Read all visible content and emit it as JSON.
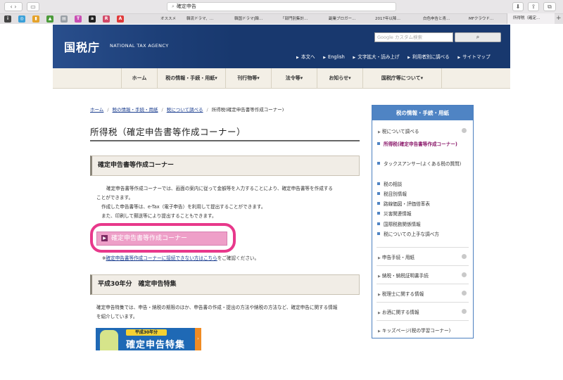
{
  "browser": {
    "url": "確定申告",
    "favorites": [
      "オススメ",
      "韓流ドラマ、…",
      "韓国ドラマ|韓…",
      "「部門別集計…",
      "副業ブロガー…",
      "2017年以降…",
      "白色申告と青…",
      "MFクラウド…"
    ],
    "active_tab": "所得税（確定…"
  },
  "header": {
    "logo_jp": "国税庁",
    "logo_en": "NATIONAL TAX AGENCY",
    "search_placeholder": "Google カスタム検索",
    "search_icon": "search-icon",
    "utility_links": [
      "本文へ",
      "English",
      "文字拡大・読み上げ",
      "利用者別に調べる",
      "サイトマップ"
    ]
  },
  "nav": {
    "items": [
      "ホーム",
      "税の情報・手続・用紙▾",
      "刊行物等▾",
      "法令等▾",
      "お知らせ▾",
      "国税庁等について▾"
    ]
  },
  "breadcrumb": {
    "items": [
      "ホーム",
      "税の情報・手続・用紙",
      "税について調べる"
    ],
    "current": "所得税(確定申告書等作成コーナー)",
    "sep": "/"
  },
  "main": {
    "title": "所得税（確定申告書等作成コーナー）",
    "section1": {
      "heading": "確定申告書等作成コーナー",
      "para1_line1": "確定申告書等作成コーナーでは、画面の案内に従って金額等を入力することにより、確定申告書等を作成する",
      "para1_line2": "ことができます。",
      "para2": "作成した申告書等は、e-Tax（電子申告）を利用して提出することができます。",
      "para3": "また、印刷して郵送等により提出することもできます。",
      "button_label": "確定申告書等作成コーナー",
      "note_prefix": "※",
      "note_link": "確定申告書等作成コーナーに接続できない方はこちら",
      "note_suffix": "をご確認ください。"
    },
    "section2": {
      "heading": "平成30年分　確定申告特集",
      "para_line1": "確定申告特集では、申告・納税の期限のほか、申告書の作成・提出の方法や納税の方法など、確定申告に関する情報",
      "para_line2": "を紹介しています。",
      "banner_small": "平成30年分",
      "banner_big": "確定申告特集",
      "banner_arrow": "›"
    }
  },
  "sidebar": {
    "heading": "税の情報・手続・用紙",
    "top_item": "税について調べる",
    "sub_items": [
      "所得税(確定申告書等作成コーナー)",
      "タックスアンサー(よくある税の質問)",
      "税の相談",
      "税目別情報",
      "路線価図・評価倍率表",
      "災害関連情報",
      "国際税務関係情報",
      "税についての上手な調べ方"
    ],
    "other_items": [
      "申告手続・用紙",
      "納税・納税証明書手続",
      "税理士に関する情報",
      "お酒に関する情報",
      "キッズページ(税の学習コーナー)"
    ]
  },
  "colors": {
    "header_bg": "#18386e",
    "accent_pink": "#e8388b",
    "sidebar_blue": "#4f84c4",
    "link_blue": "#1a3d8f"
  }
}
